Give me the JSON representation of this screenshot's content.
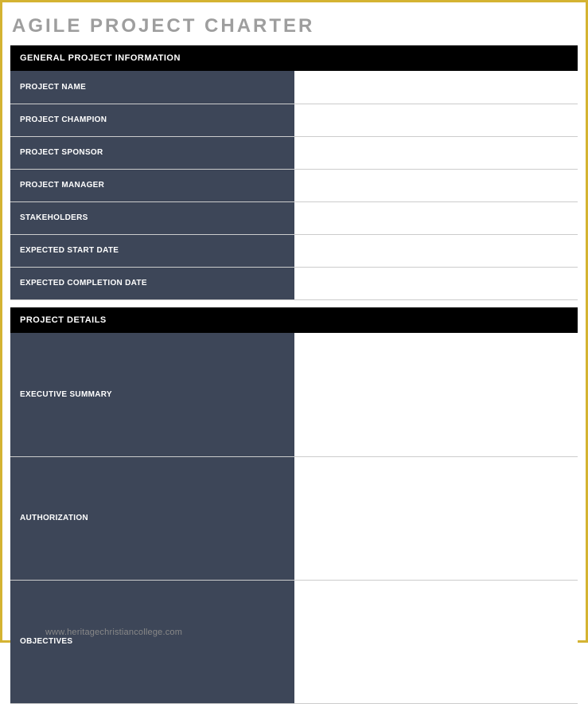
{
  "title": "AGILE PROJECT CHARTER",
  "sections": {
    "general": {
      "header": "GENERAL PROJECT INFORMATION",
      "fields": {
        "project_name": {
          "label": "PROJECT NAME",
          "value": ""
        },
        "project_champion": {
          "label": "PROJECT CHAMPION",
          "value": ""
        },
        "project_sponsor": {
          "label": "PROJECT SPONSOR",
          "value": ""
        },
        "project_manager": {
          "label": "PROJECT MANAGER",
          "value": ""
        },
        "stakeholders": {
          "label": "STAKEHOLDERS",
          "value": ""
        },
        "expected_start": {
          "label": "EXPECTED START DATE",
          "value": ""
        },
        "expected_completion": {
          "label": "EXPECTED COMPLETION DATE",
          "value": ""
        }
      }
    },
    "details": {
      "header": "PROJECT DETAILS",
      "fields": {
        "executive_summary": {
          "label": "EXECUTIVE SUMMARY",
          "value": ""
        },
        "authorization": {
          "label": "AUTHORIZATION",
          "value": ""
        },
        "objectives": {
          "label": "OBJECTIVES",
          "value": ""
        }
      }
    }
  },
  "watermark": "www.heritagechristiancollege.com"
}
